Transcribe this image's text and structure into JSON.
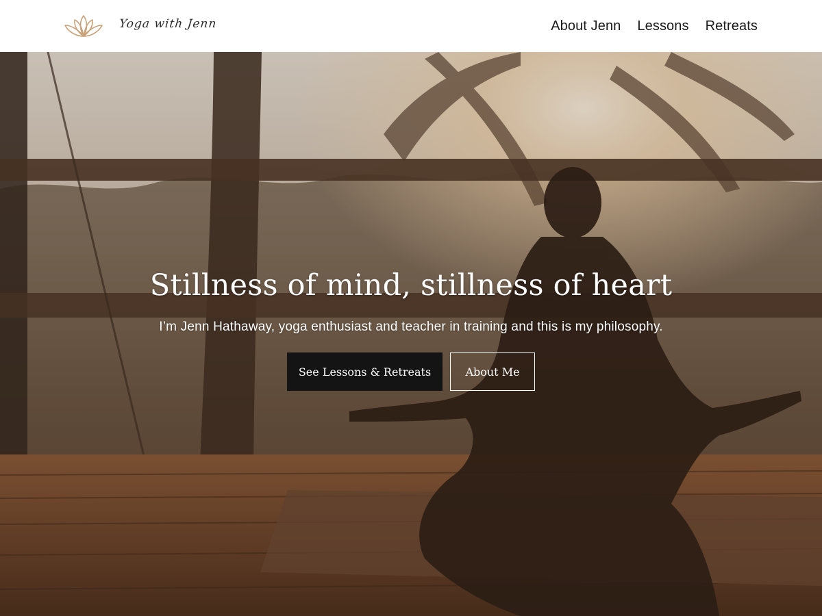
{
  "header": {
    "brand_name": "Yoga with Jenn",
    "logo_icon": "lotus-icon",
    "nav": [
      {
        "label": "About Jenn"
      },
      {
        "label": "Lessons"
      },
      {
        "label": "Retreats"
      }
    ]
  },
  "hero": {
    "background": "sunset-meditation-photo",
    "title": "Stillness of mind, stillness of heart",
    "subtitle": "I’m Jenn Hathaway, yoga enthusiast and teacher in training and this is my philosophy.",
    "primary_button": "See Lessons & Retreats",
    "secondary_button": "About Me"
  },
  "colors": {
    "logo_accent": "#c9a27a",
    "primary_button_bg": "#141414",
    "text_on_hero": "#ffffff"
  }
}
